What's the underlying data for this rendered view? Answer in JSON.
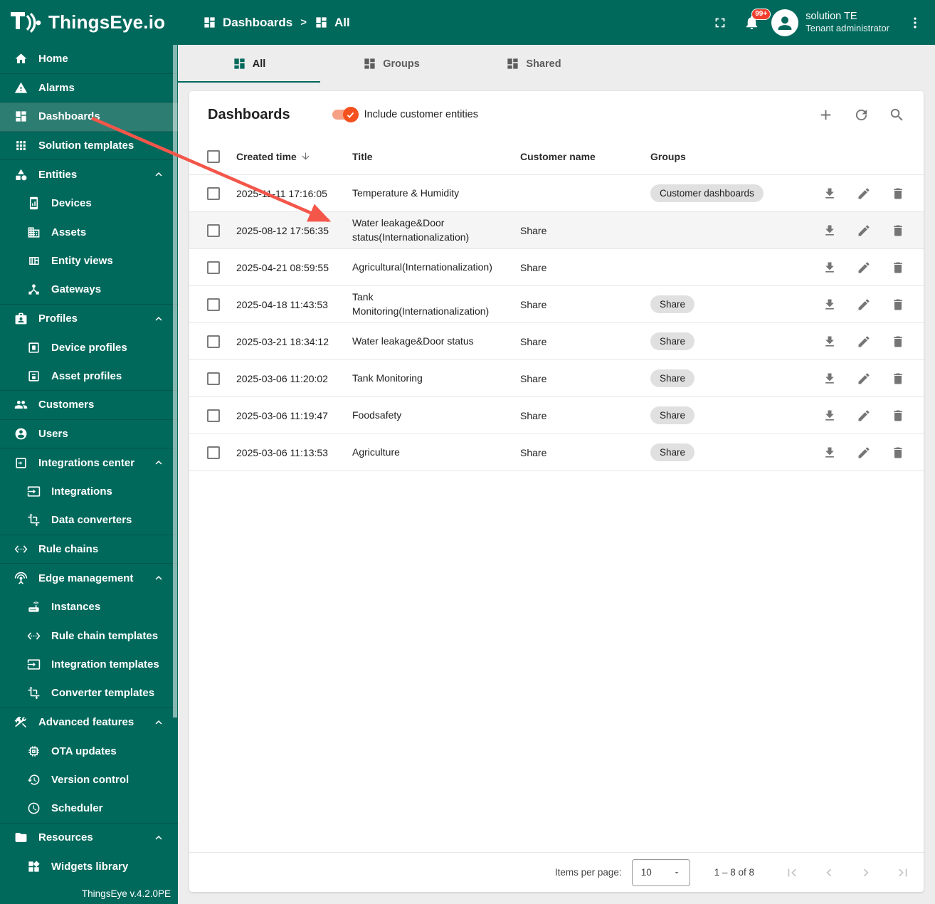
{
  "app": {
    "logo_text": "ThingsEye.io",
    "version": "ThingsEye v.4.2.0PE"
  },
  "header": {
    "breadcrumb": [
      {
        "label": "Dashboards",
        "icon": "dashboards-icon"
      },
      {
        "label": "All",
        "icon": "dashboards-icon"
      }
    ],
    "breadcrumb_separator": ">",
    "notifications_badge": "99+",
    "user": {
      "name": "solution TE",
      "role": "Tenant administrator"
    }
  },
  "sidebar": {
    "items": [
      {
        "label": "Home",
        "icon": "home-icon",
        "level": 0,
        "divider": true
      },
      {
        "label": "Alarms",
        "icon": "alarms-icon",
        "level": 0,
        "divider": true
      },
      {
        "label": "Dashboards",
        "icon": "dashboards-icon",
        "level": 0,
        "active": true,
        "divider": true
      },
      {
        "label": "Solution templates",
        "icon": "solution-templates-icon",
        "level": 0,
        "divider": true
      },
      {
        "label": "Entities",
        "icon": "entities-icon",
        "level": 0,
        "expanded": true
      },
      {
        "label": "Devices",
        "icon": "devices-icon",
        "level": 1
      },
      {
        "label": "Assets",
        "icon": "assets-icon",
        "level": 1
      },
      {
        "label": "Entity views",
        "icon": "entity-views-icon",
        "level": 1
      },
      {
        "label": "Gateways",
        "icon": "gateways-icon",
        "level": 1,
        "divider": true
      },
      {
        "label": "Profiles",
        "icon": "profiles-icon",
        "level": 0,
        "expanded": true
      },
      {
        "label": "Device profiles",
        "icon": "device-profiles-icon",
        "level": 1
      },
      {
        "label": "Asset profiles",
        "icon": "asset-profiles-icon",
        "level": 1,
        "divider": true
      },
      {
        "label": "Customers",
        "icon": "customers-icon",
        "level": 0,
        "divider": true
      },
      {
        "label": "Users",
        "icon": "users-icon",
        "level": 0,
        "divider": true
      },
      {
        "label": "Integrations center",
        "icon": "integrations-center-icon",
        "level": 0,
        "expanded": true
      },
      {
        "label": "Integrations",
        "icon": "integrations-icon",
        "level": 1
      },
      {
        "label": "Data converters",
        "icon": "data-converters-icon",
        "level": 1,
        "divider": true
      },
      {
        "label": "Rule chains",
        "icon": "rule-chains-icon",
        "level": 0,
        "divider": true
      },
      {
        "label": "Edge management",
        "icon": "edge-management-icon",
        "level": 0,
        "expanded": true
      },
      {
        "label": "Instances",
        "icon": "instances-icon",
        "level": 1
      },
      {
        "label": "Rule chain templates",
        "icon": "rule-chains-icon",
        "level": 1
      },
      {
        "label": "Integration templates",
        "icon": "integrations-icon",
        "level": 1
      },
      {
        "label": "Converter templates",
        "icon": "data-converters-icon",
        "level": 1,
        "divider": true
      },
      {
        "label": "Advanced features",
        "icon": "advanced-features-icon",
        "level": 0,
        "expanded": true
      },
      {
        "label": "OTA updates",
        "icon": "ota-updates-icon",
        "level": 1
      },
      {
        "label": "Version control",
        "icon": "version-control-icon",
        "level": 1
      },
      {
        "label": "Scheduler",
        "icon": "scheduler-icon",
        "level": 1,
        "divider": true
      },
      {
        "label": "Resources",
        "icon": "resources-icon",
        "level": 0,
        "expanded": true
      },
      {
        "label": "Widgets library",
        "icon": "widgets-library-icon",
        "level": 1
      }
    ]
  },
  "tabs": [
    {
      "label": "All",
      "icon": "dashboards-icon",
      "active": true
    },
    {
      "label": "Groups",
      "icon": "dashboards-icon",
      "active": false
    },
    {
      "label": "Shared",
      "icon": "dashboards-icon",
      "active": false
    }
  ],
  "card": {
    "title": "Dashboards",
    "toggle_label": "Include customer entities",
    "toggle_on": true
  },
  "table": {
    "columns": [
      "Created time",
      "Title",
      "Customer name",
      "Groups"
    ],
    "sorted_column": "Created time",
    "sort_direction": "desc",
    "rows": [
      {
        "created": "2025-11-11 17:16:05",
        "title": "Temperature & Humidity",
        "customer": "",
        "groups": [
          "Customer dashboards"
        ],
        "highlight": false
      },
      {
        "created": "2025-08-12 17:56:35",
        "title": "Water leakage&Door status(Internationalization)",
        "customer": "Share",
        "groups": [],
        "highlight": true
      },
      {
        "created": "2025-04-21 08:59:55",
        "title": "Agricultural(Internationalization)",
        "customer": "Share",
        "groups": [],
        "highlight": false
      },
      {
        "created": "2025-04-18 11:43:53",
        "title": "Tank Monitoring(Internationalization)",
        "customer": "Share",
        "groups": [
          "Share"
        ],
        "highlight": false
      },
      {
        "created": "2025-03-21 18:34:12",
        "title": "Water leakage&Door status",
        "customer": "Share",
        "groups": [
          "Share"
        ],
        "highlight": false
      },
      {
        "created": "2025-03-06 11:20:02",
        "title": "Tank Monitoring",
        "customer": "Share",
        "groups": [
          "Share"
        ],
        "highlight": false
      },
      {
        "created": "2025-03-06 11:19:47",
        "title": "Foodsafety",
        "customer": "Share",
        "groups": [
          "Share"
        ],
        "highlight": false
      },
      {
        "created": "2025-03-06 11:13:53",
        "title": "Agriculture",
        "customer": "Share",
        "groups": [
          "Share"
        ],
        "highlight": false
      }
    ]
  },
  "pagination": {
    "items_per_page_label": "Items per page:",
    "page_size": "10",
    "range": "1 – 8 of 8"
  },
  "colors": {
    "teal": "#00695c",
    "active_nav": "#2e7d72",
    "toggle_orange": "#f4511e",
    "badge_red": "#f03e2e",
    "arrow_red": "#f4564a",
    "chip_gray": "#e0e0e0"
  }
}
